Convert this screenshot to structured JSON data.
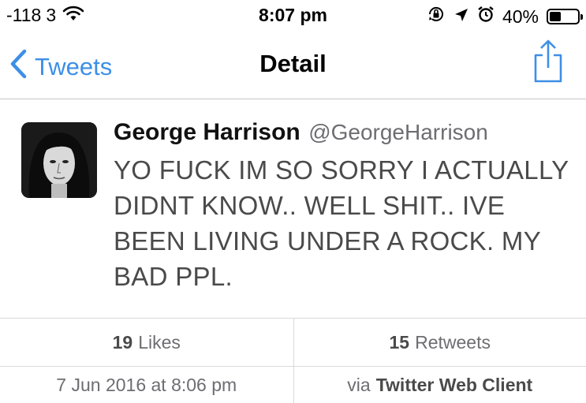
{
  "status_bar": {
    "signal": "-118",
    "carrier_digit": "3",
    "time": "8:07 pm",
    "battery_percent": "40%",
    "battery_level": 0.4
  },
  "nav": {
    "back_label": "Tweets",
    "title": "Detail",
    "accent_color": "#3d8fe6"
  },
  "tweet": {
    "display_name": "George Harrison",
    "handle": "@GeorgeHarrison",
    "text": "YO FUCK IM SO SORRY I ACTUALLY DIDNT KNOW.. WELL SHIT.. IVE BEEN LIVING UNDER A ROCK. MY BAD PPL."
  },
  "stats": {
    "likes_count": "19",
    "likes_label": "Likes",
    "retweets_count": "15",
    "retweets_label": "Retweets"
  },
  "meta": {
    "timestamp": "7 Jun 2016 at 8:06 pm",
    "via_prefix": "via",
    "client": "Twitter Web Client"
  }
}
